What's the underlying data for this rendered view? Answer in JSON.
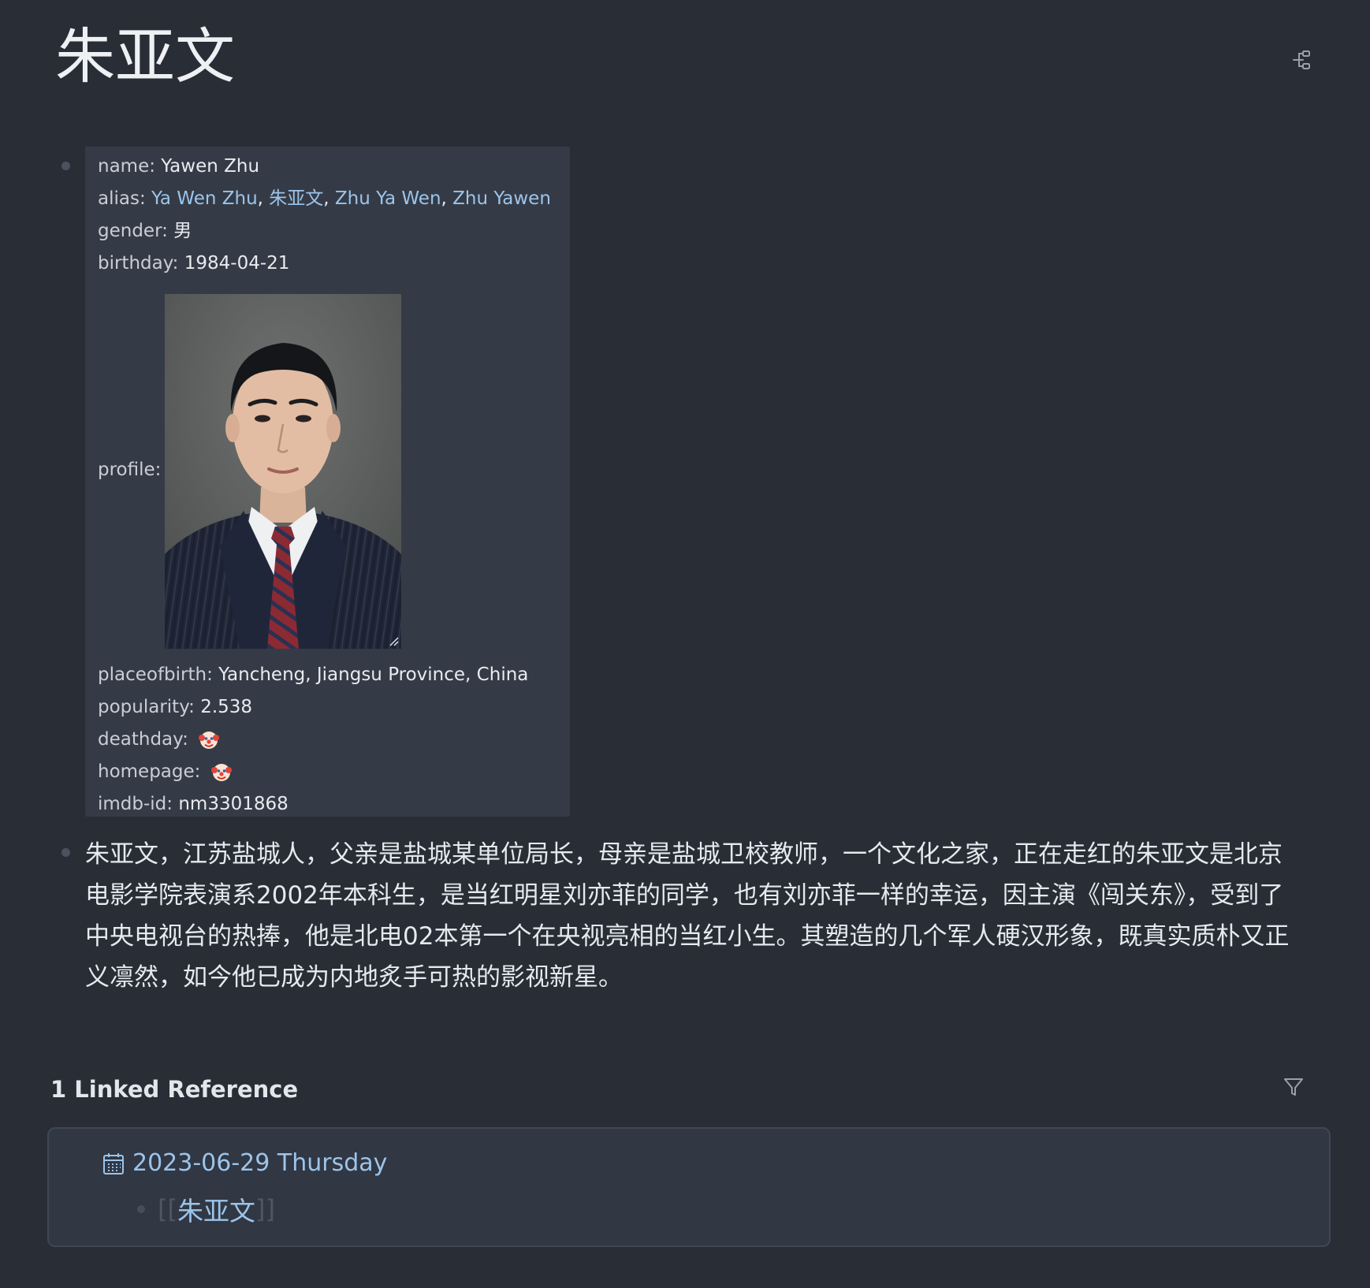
{
  "page": {
    "title": "朱亚文"
  },
  "properties": {
    "name": {
      "key": "name:",
      "value": "Yawen Zhu"
    },
    "alias": {
      "key": "alias:",
      "values": [
        "Ya Wen Zhu",
        "朱亚文",
        "Zhu Ya Wen",
        "Zhu Yawen"
      ],
      "separator": ","
    },
    "gender": {
      "key": "gender:",
      "value": "男"
    },
    "birthday": {
      "key": "birthday:",
      "value": "1984-04-21"
    },
    "profile": {
      "key": "profile:"
    },
    "placeofbirth": {
      "key": "placeofbirth:",
      "value": "Yancheng, Jiangsu Province, China"
    },
    "popularity": {
      "key": "popularity:",
      "value": "2.538"
    },
    "deathday": {
      "key": "deathday:",
      "value_icon": "clown-face-icon"
    },
    "homepage": {
      "key": "homepage:",
      "value_icon": "clown-face-icon"
    },
    "imdb_id": {
      "key": "imdb-id:",
      "value": "nm3301868"
    }
  },
  "bio": {
    "text": "朱亚文，江苏盐城人，父亲是盐城某单位局长，母亲是盐城卫校教师，一个文化之家，正在走红的朱亚文是北京电影学院表演系2002年本科生，是当红明星刘亦菲的同学，也有刘亦菲一样的幸运，因主演《闯关东》，受到了中央电视台的热捧，他是北电02本第一个在央视亮相的当红小生。其塑造的几个军人硬汉形象，既真实质朴又正义凛然，如今他已成为内地炙手可热的影视新星。"
  },
  "linked_references": {
    "header": "1 Linked Reference",
    "items": [
      {
        "date": "2023-06-29 Thursday",
        "bracket_open": "[[",
        "link": "朱亚文",
        "bracket_close": "]]"
      }
    ]
  },
  "colors": {
    "background": "#282d36",
    "properties_bg": "#353b46",
    "link": "#9cc4ea",
    "text": "#e6e9ed"
  }
}
